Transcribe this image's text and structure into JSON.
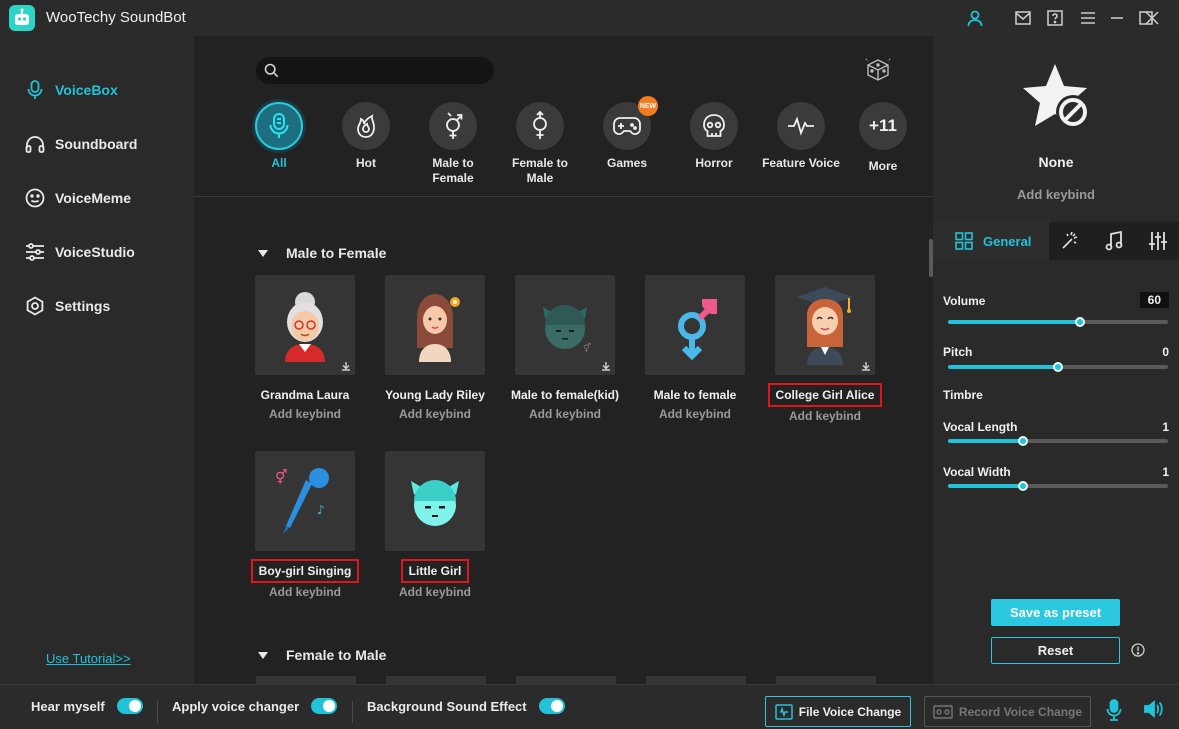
{
  "app": {
    "title": "WooTechy SoundBot"
  },
  "sidebar": {
    "items": [
      {
        "label": "VoiceBox",
        "icon": "mic-icon",
        "active": true
      },
      {
        "label": "Soundboard",
        "icon": "headphones-icon"
      },
      {
        "label": "VoiceMeme",
        "icon": "smiley-icon"
      },
      {
        "label": "VoiceStudio",
        "icon": "sliders-icon"
      },
      {
        "label": "Settings",
        "icon": "gear-icon"
      }
    ],
    "tutorial_link": "Use Tutorial>>"
  },
  "search": {
    "placeholder": ""
  },
  "categories": [
    {
      "label": "All",
      "icon": "mic-icon",
      "active": true
    },
    {
      "label": "Hot",
      "icon": "flame-icon"
    },
    {
      "label": "Male to Female",
      "icon": "male-to-female-icon"
    },
    {
      "label": "Female to Male",
      "icon": "female-to-male-icon"
    },
    {
      "label": "Games",
      "icon": "gamepad-icon",
      "badge": "NEW"
    },
    {
      "label": "Horror",
      "icon": "skull-icon"
    },
    {
      "label": "Feature Voice",
      "icon": "waveform-icon"
    },
    {
      "label": "More",
      "count": "+11"
    }
  ],
  "sections": [
    {
      "title": "Male to Female",
      "voices": [
        {
          "name": "Grandma Laura",
          "keybind": "Add keybind",
          "highlighted": false
        },
        {
          "name": "Young Lady Riley",
          "keybind": "Add keybind",
          "highlighted": false
        },
        {
          "name": "Male to female(kid)",
          "keybind": "Add keybind",
          "highlighted": false
        },
        {
          "name": "Male to female",
          "keybind": "Add keybind",
          "highlighted": false
        },
        {
          "name": "College Girl Alice",
          "keybind": "Add keybind",
          "highlighted": true
        },
        {
          "name": "Boy-girl Singing",
          "keybind": "Add keybind",
          "highlighted": true
        },
        {
          "name": "Little Girl",
          "keybind": "Add keybind",
          "highlighted": true
        }
      ]
    },
    {
      "title": "Female to Male",
      "voices": []
    }
  ],
  "preset": {
    "name": "None",
    "keybind": "Add keybind"
  },
  "panel_tabs": {
    "general": "General",
    "icons": [
      "magic-wand-icon",
      "music-note-icon",
      "equalizer-icon"
    ]
  },
  "sliders": {
    "volume": {
      "label": "Volume",
      "value": "60",
      "fraction": 0.6
    },
    "pitch": {
      "label": "Pitch",
      "value": "0",
      "fraction": 0.5
    },
    "timbre": {
      "label": "Timbre"
    },
    "vocal_length": {
      "label": "Vocal Length",
      "value": "1",
      "fraction": 0.34
    },
    "vocal_width": {
      "label": "Vocal Width",
      "value": "1",
      "fraction": 0.34
    }
  },
  "buttons": {
    "save_preset": "Save as preset",
    "reset": "Reset"
  },
  "bottom": {
    "hear_myself": "Hear myself",
    "apply_voice_changer": "Apply voice changer",
    "background_sound_effect": "Background Sound Effect",
    "file_voice_change": "File Voice Change",
    "record_voice_change": "Record Voice Change"
  },
  "colors": {
    "accent": "#22c2d8",
    "highlight_border": "#e0161d",
    "badge": "#f47c20"
  }
}
